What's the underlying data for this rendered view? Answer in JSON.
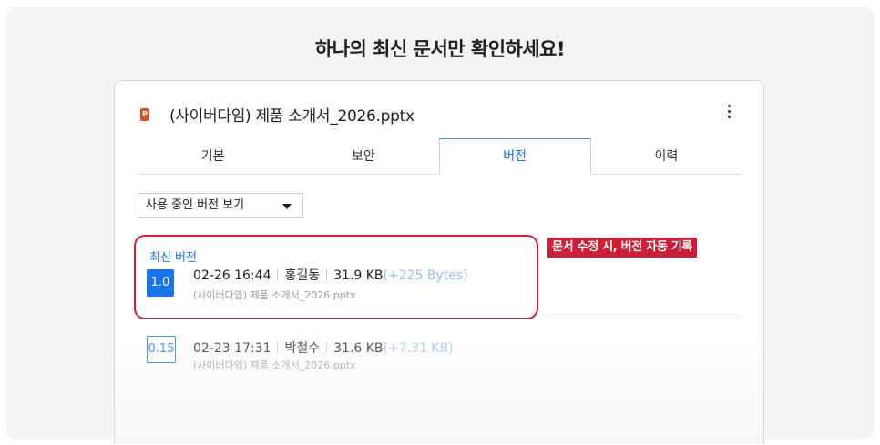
{
  "headline": "하나의 최신 문서만 확인하세요!",
  "file": {
    "icon": "powerpoint-file-icon",
    "icon_letter": "P",
    "title": "(사이버다임) 제품 소개서_2026.pptx"
  },
  "tabs": [
    "기본",
    "보안",
    "버전",
    "이력"
  ],
  "active_tab": "버전",
  "version_filter": {
    "selected": "사용 중인 버전 보기"
  },
  "latest": {
    "label": "최신 버전",
    "version": "1.0",
    "datetime": "02-26 16:44",
    "author": "홍길동",
    "size": "31.9 KB",
    "delta": "(+225 Bytes)",
    "filename": "(사이버다임) 제품 소개서_2026.pptx"
  },
  "previous": {
    "version": "0.15",
    "datetime": "02-23 17:31",
    "author": "박철수",
    "size": "31.6 KB",
    "delta": "(+7.31 KB)",
    "filename": "(사이버다임) 제품 소개서_2026.pptx"
  },
  "callout": "문서 수정 시, 버전 자동 기록",
  "colors": {
    "accent": "#1b73e8",
    "highlight": "#cc1f3a",
    "delta": "#9cc0f2"
  }
}
